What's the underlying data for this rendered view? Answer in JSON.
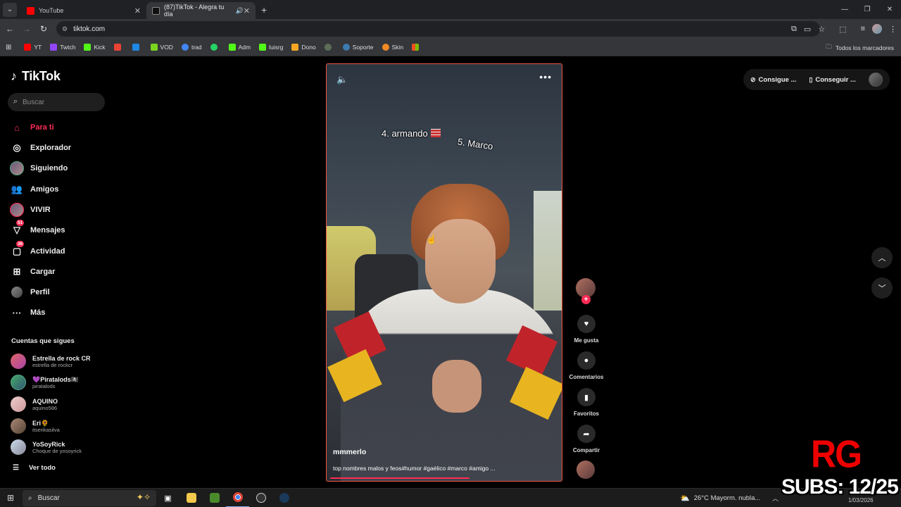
{
  "browser": {
    "tabs": [
      {
        "label": "YouTube",
        "active": false,
        "favicon_color": "#ff0000"
      },
      {
        "label": "(87)TikTok - Alegra tu día",
        "active": true,
        "favicon_color": "#000000"
      }
    ],
    "new_tab": "+",
    "url": "tiktok.com",
    "bookmarks": [
      {
        "label": "YT",
        "icon_color": "#ff0000"
      },
      {
        "label": "Twtch",
        "icon_color": "#9146ff"
      },
      {
        "label": "Kick",
        "icon_color": "#53fc18"
      },
      {
        "label": "",
        "icon_color": "#ea4335"
      },
      {
        "label": "",
        "icon_color": "#1e88e5"
      },
      {
        "label": "VOD",
        "icon_color": "#7cd31e"
      },
      {
        "label": "trad",
        "icon_color": "#4285f4"
      },
      {
        "label": "",
        "icon_color": "#25d366"
      },
      {
        "label": "Adm",
        "icon_color": "#53fc18"
      },
      {
        "label": "luisrg",
        "icon_color": "#53fc18"
      },
      {
        "label": "Dono",
        "icon_color": "#f6a623"
      },
      {
        "label": "",
        "icon_color": "#5c6d5a"
      },
      {
        "label": "Soporte",
        "icon_color": "#3d7ab0"
      },
      {
        "label": "Skin",
        "icon_color": "#f08a24"
      },
      {
        "label": "",
        "icon_color": "#f25022"
      }
    ],
    "all_bookmarks": "Todos los marcadores"
  },
  "sidebar": {
    "logo": "TikTok",
    "search_placeholder": "Buscar",
    "items": [
      {
        "label": "Para ti",
        "icon": "home-icon",
        "active": true
      },
      {
        "label": "Explorador",
        "icon": "compass-icon"
      },
      {
        "label": "Siguiendo",
        "icon": "following-avatar-icon"
      },
      {
        "label": "Amigos",
        "icon": "friends-icon"
      },
      {
        "label": "VIVIR",
        "icon": "live-avatar-icon"
      },
      {
        "label": "Mensajes",
        "icon": "messages-icon",
        "badge": "51"
      },
      {
        "label": "Actividad",
        "icon": "activity-icon",
        "badge": "36"
      },
      {
        "label": "Cargar",
        "icon": "upload-icon"
      },
      {
        "label": "Perfil",
        "icon": "profile-icon"
      },
      {
        "label": "Más",
        "icon": "more-dots-icon"
      }
    ],
    "following_header": "Cuentas que sigues",
    "following": [
      {
        "name": "Estrella de rock CR",
        "handle": "estrella de rockcr"
      },
      {
        "name": "💜Piratalods🏴‍☠️",
        "handle": "piratalods"
      },
      {
        "name": "AQUINO",
        "handle": "aquino586"
      },
      {
        "name": "Eri🌻",
        "handle": "itserikasilva"
      },
      {
        "name": "YoSoyRick",
        "handle": "Choque de yosoyrick"
      }
    ],
    "see_all": "Ver todo"
  },
  "video": {
    "overlay_text_1": "4. armando",
    "overlay_text_2": "5. Marco",
    "author": "mmmerlo",
    "description": "top nombres malos y feos#humor #gaélico #marco #amigo ...",
    "progress": 0.6
  },
  "actions": {
    "like_label": "Me gusta",
    "comments_label": "Comentarios",
    "favorites_label": "Favoritos",
    "share_label": "Compartir"
  },
  "top_right": {
    "coins_label": "Consigue ...",
    "app_label": "Conseguir ..."
  },
  "overlay": {
    "logo": "RG",
    "subs": "SUBS: 12/25"
  },
  "taskbar": {
    "search_placeholder": "Buscar",
    "weather": "26°C  Mayorm. nubla...",
    "date": "1/03/2026"
  },
  "colors": {
    "tiktok_accent": "#fe2c55",
    "video_border": "#e54444"
  }
}
